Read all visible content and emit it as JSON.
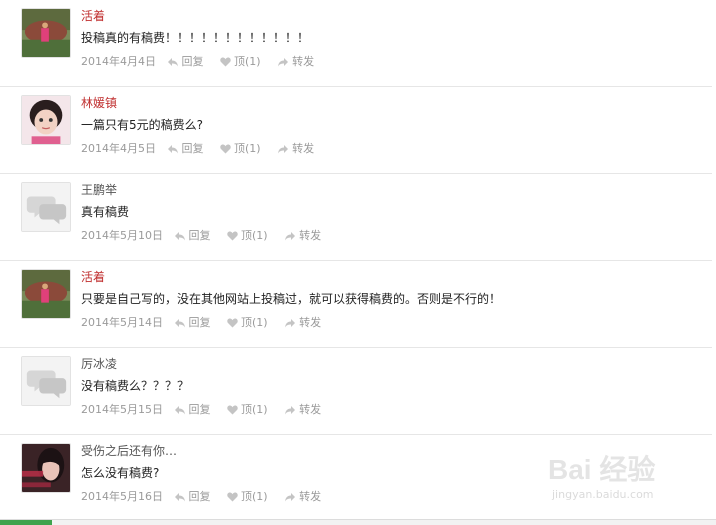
{
  "comments": [
    {
      "author": "活着",
      "author_color": "red",
      "avatar": "landscape-photo",
      "content": "投稿真的有稿费！！！！！！！！！！！！",
      "date": "2014年4月4日",
      "reply_label": "回复",
      "like_label": "顶(1)",
      "forward_label": "转发"
    },
    {
      "author": "林媛镇",
      "author_color": "red",
      "avatar": "portrait-photo",
      "content": "一篇只有5元的稿费么?",
      "date": "2014年4月5日",
      "reply_label": "回复",
      "like_label": "顶(1)",
      "forward_label": "转发"
    },
    {
      "author": "王鹏举",
      "author_color": "gray",
      "avatar": "default-chat-icon",
      "content": "真有稿费",
      "date": "2014年5月10日",
      "reply_label": "回复",
      "like_label": "顶(1)",
      "forward_label": "转发"
    },
    {
      "author": "活着",
      "author_color": "red",
      "avatar": "landscape-photo",
      "content": "只要是自己写的，没在其他网站上投稿过，就可以获得稿费的。否则是不行的！",
      "date": "2014年5月14日",
      "reply_label": "回复",
      "like_label": "顶(1)",
      "forward_label": "转发"
    },
    {
      "author": "厉冰凌",
      "author_color": "gray",
      "avatar": "default-chat-icon",
      "content": "没有稿费么？？？？",
      "date": "2014年5月15日",
      "reply_label": "回复",
      "like_label": "顶(1)",
      "forward_label": "转发"
    },
    {
      "author": "受伤之后还有你…",
      "author_color": "gray",
      "avatar": "woman-photo",
      "content": "怎么没有稿费?",
      "date": "2014年5月16日",
      "reply_label": "回复",
      "like_label": "顶(1)",
      "forward_label": "转发"
    }
  ],
  "watermark": {
    "logo_text": "Bai 经验",
    "url": "jingyan.baidu.com"
  },
  "colors": {
    "author_red": "#c03030",
    "author_gray": "#555555",
    "meta_gray": "#9a9a9a",
    "divider": "#e6e6e6"
  }
}
